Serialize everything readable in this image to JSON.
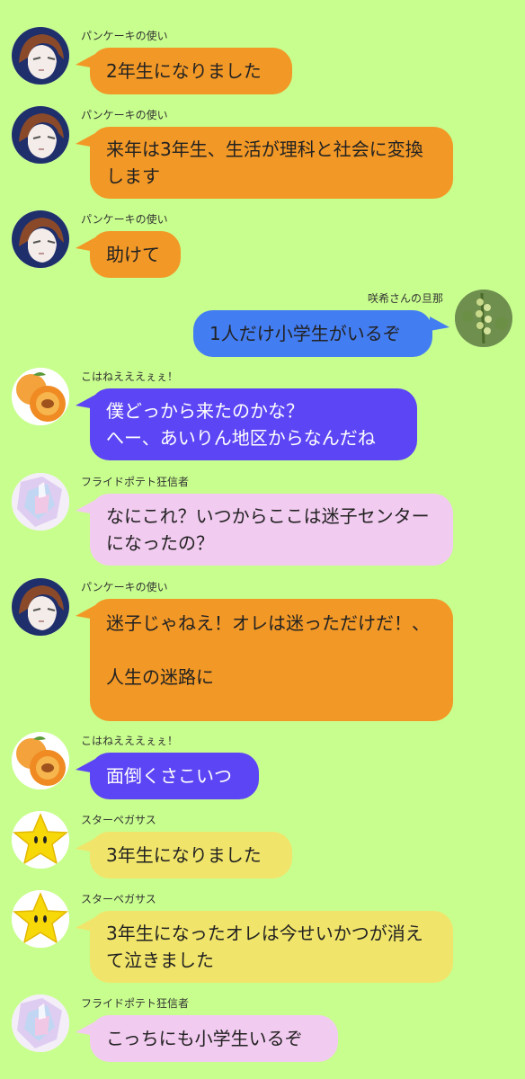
{
  "messages": [
    {
      "sender": "パンケーキの使い",
      "text": "2年生になりました",
      "color": "#f29826",
      "avatar": "anime-boy-icon"
    },
    {
      "sender": "パンケーキの使い",
      "text": "来年は3年生、生活が理科と社会に変換します",
      "color": "#f29826",
      "avatar": "anime-boy-icon"
    },
    {
      "sender": "パンケーキの使い",
      "text": "助けて",
      "color": "#f29826",
      "avatar": "anime-boy-icon"
    },
    {
      "sender": "咲希さんの旦那",
      "text": "1人だけ小学生がいるぞ",
      "color": "#437df2",
      "avatar": "plant-icon"
    },
    {
      "sender": "こはねえええぇぇ！",
      "text": "僕どっから来たのかな？\nへー、あいりん地区からなんだね",
      "color": "#5c45f4",
      "avatar": "apricot-icon"
    },
    {
      "sender": "フライドポテト狂信者",
      "text": "なにこれ？いつからここは迷子センターになったの？",
      "color": "#f2cbf0",
      "avatar": "pastel-crystal-icon"
    },
    {
      "sender": "パンケーキの使い",
      "text": "迷子じゃねえ！オレは迷っただけだ！、\n\n人生の迷路に",
      "color": "#f29826",
      "avatar": "anime-boy-icon"
    },
    {
      "sender": "こはねえええぇぇ！",
      "text": "面倒くさこいつ",
      "color": "#5c45f4",
      "avatar": "apricot-icon"
    },
    {
      "sender": "スターペガサス",
      "text": "3年生になりました",
      "color": "#f1e46a",
      "avatar": "star-icon"
    },
    {
      "sender": "スターペガサス",
      "text": "3年生になったオレは今せいかつが消えて泣きました",
      "color": "#f1e46a",
      "avatar": "star-icon"
    },
    {
      "sender": "フライドポテト狂信者",
      "text": "こっちにも小学生いるぞ",
      "color": "#f2cbf0",
      "avatar": "pastel-crystal-icon"
    }
  ]
}
